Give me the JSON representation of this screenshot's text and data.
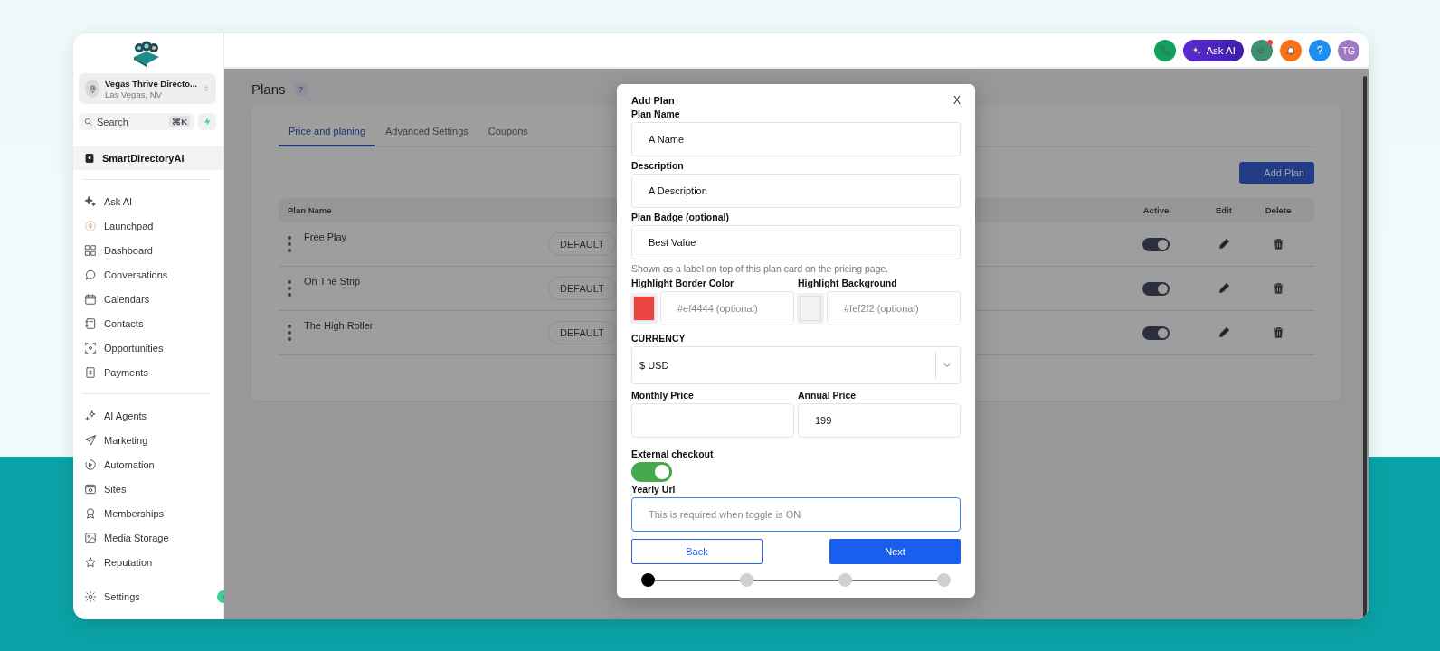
{
  "sidebar": {
    "account": {
      "name": "Vegas Thrive Directo...",
      "location": "Las Vegas, NV"
    },
    "search": {
      "placeholder": "Search",
      "shortcut": "⌘K"
    },
    "workspace": "SmartDirectoryAI",
    "nav_groups": [
      [
        {
          "label": "Ask AI"
        },
        {
          "label": "Launchpad"
        },
        {
          "label": "Dashboard"
        },
        {
          "label": "Conversations"
        },
        {
          "label": "Calendars"
        },
        {
          "label": "Contacts"
        },
        {
          "label": "Opportunities"
        },
        {
          "label": "Payments"
        }
      ],
      [
        {
          "label": "AI Agents"
        },
        {
          "label": "Marketing"
        },
        {
          "label": "Automation"
        },
        {
          "label": "Sites"
        },
        {
          "label": "Memberships"
        },
        {
          "label": "Media Storage"
        },
        {
          "label": "Reputation"
        }
      ]
    ],
    "settings": "Settings"
  },
  "topbar": {
    "ask_ai": "Ask AI",
    "help": "?",
    "avatar": "TG"
  },
  "page": {
    "title": "Plans",
    "help": "?",
    "tabs": [
      {
        "label": "Price and planing",
        "selected": true
      },
      {
        "label": "Advanced Settings",
        "selected": false
      },
      {
        "label": "Coupons",
        "selected": false
      }
    ],
    "add_button": "Add Plan",
    "table": {
      "columns": [
        "Plan Name",
        "Active",
        "Edit",
        "Delete"
      ],
      "rows": [
        {
          "name": "Free Play",
          "badge": "DEFAULT",
          "active": true
        },
        {
          "name": "On The Strip",
          "badge": "DEFAULT",
          "active": true
        },
        {
          "name": "The High Roller",
          "badge": "DEFAULT",
          "active": true
        }
      ]
    }
  },
  "modal": {
    "title": "Add Plan",
    "close": "X",
    "plan_name": {
      "label": "Plan Name",
      "value": "A Name"
    },
    "description": {
      "label": "Description",
      "value": "A Description"
    },
    "badge": {
      "label": "Plan Badge (optional)",
      "value": "Best Value",
      "hint": "Shown as a label on top of this plan card on the pricing page."
    },
    "colors": [
      {
        "label": "Highlight Border Color",
        "color": "#ef4444",
        "placeholder": "#ef4444 (optional)"
      },
      {
        "label": "Highlight Background",
        "color": "#f2f2f2",
        "placeholder": "#fef2f2 (optional)"
      }
    ],
    "currency": {
      "label": "CURRENCY",
      "value": "$ USD"
    },
    "prices": [
      {
        "label": "Monthly Price"
      },
      {
        "label": "Annual Price",
        "value": "199"
      }
    ],
    "external_checkout": {
      "label": "External checkout",
      "on": true
    },
    "yearly_url": {
      "label": "Yearly Url",
      "placeholder": "This is required when toggle is ON"
    },
    "buttons": {
      "back": "Back",
      "next": "Next"
    },
    "steps": [
      {
        "selected": true
      },
      {
        "selected": false
      },
      {
        "selected": false
      },
      {
        "selected": false
      }
    ]
  }
}
